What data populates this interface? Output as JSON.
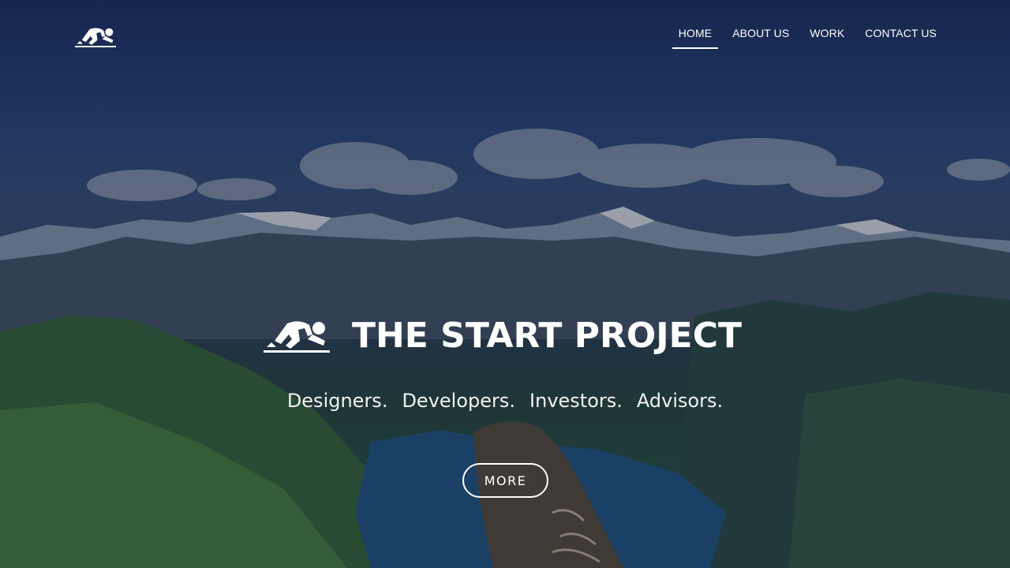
{
  "header": {
    "logo_icon": "sprinter-start-icon",
    "nav": [
      {
        "label": "HOME",
        "active": true
      },
      {
        "label": "ABOUT US",
        "active": false
      },
      {
        "label": "WORK",
        "active": false
      },
      {
        "label": "CONTACT US",
        "active": false
      }
    ]
  },
  "hero": {
    "background": "mountain-lake-landscape-with-hiking-boot",
    "title_icon": "sprinter-start-icon",
    "title": "THE START PROJECT",
    "tagline": [
      "Designers.",
      "Developers.",
      "Investors.",
      "Advisors."
    ],
    "more_label": "MORE"
  },
  "colors": {
    "text": "#ffffff",
    "overlay": "#081028"
  }
}
